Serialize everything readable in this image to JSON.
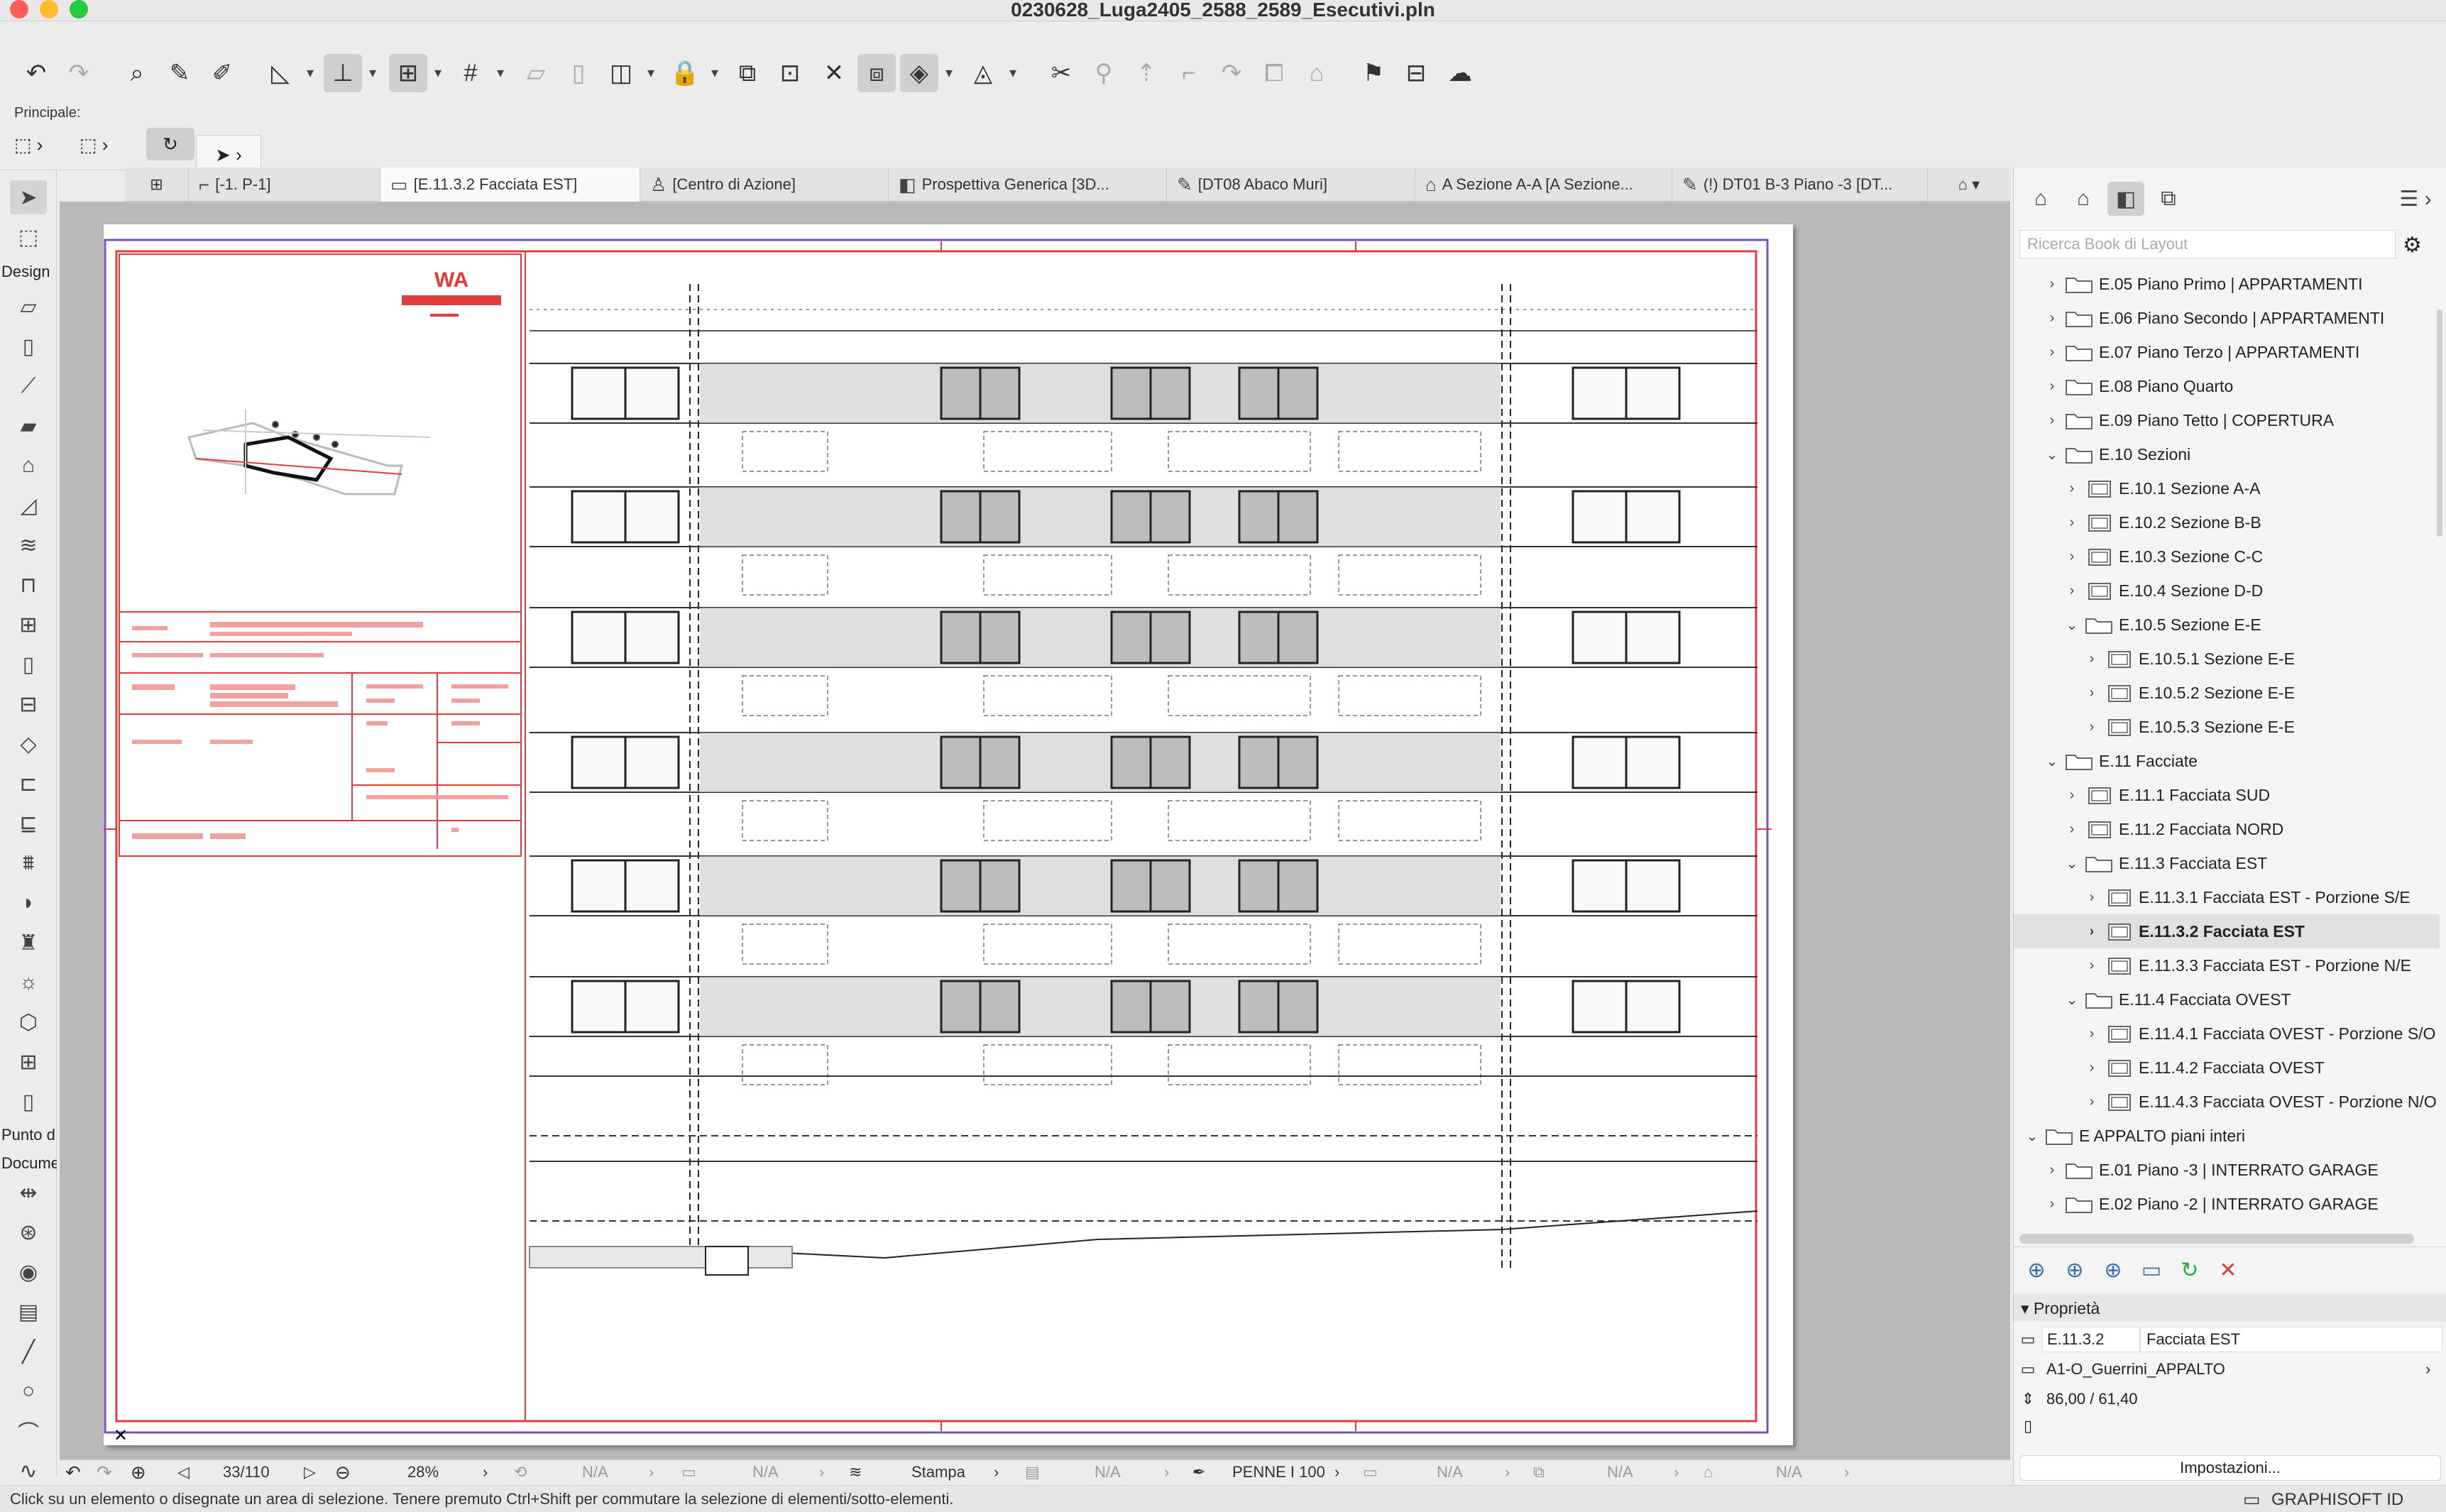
{
  "window": {
    "title": "0230628_Luga2405_2588_2589_Esecutivi.pln"
  },
  "toolbar": {
    "principale_label": "Principale:",
    "icons": [
      "undo-icon",
      "redo-icon",
      "find-select-icon",
      "eyedropper-icon",
      "inject-icon",
      "measure-icon",
      "snap-guides-icon",
      "snap-points-icon",
      "grid-snap-icon",
      "layer-icon",
      "3d-view-icon",
      "display-icon",
      "lock-icon",
      "elevation-icon",
      "label-icon",
      "trace-icon",
      "fit-selection-icon",
      "zoom-window-icon",
      "orbit-icon",
      "scissors-icon",
      "wand-icon",
      "move-icon",
      "rotate-icon",
      "mirror-icon",
      "elevate-icon",
      "stretch-icon",
      "flag-icon",
      "schedule-icon",
      "cloud-icon"
    ]
  },
  "tabs": [
    {
      "label": "[-1. P-1]",
      "icon": "floorplan-icon"
    },
    {
      "label": "[E.11.3.2 Facciata EST]",
      "icon": "layout-icon",
      "active": true
    },
    {
      "label": "[Centro di Azione]",
      "icon": "action-center-icon"
    },
    {
      "label": "Prospettiva Generica [3D...",
      "icon": "3d-icon"
    },
    {
      "label": "[DT08 Abaco Muri]",
      "icon": "schedule-icon"
    },
    {
      "label": "A Sezione A-A [A Sezione...",
      "icon": "section-icon"
    },
    {
      "label": "(!) DT01 B-3 Piano -3 [DT...",
      "icon": "detail-icon"
    }
  ],
  "toolbox": {
    "design_label": "Design",
    "punto_label": "Punto d",
    "docum_label": "Docume"
  },
  "bottom": {
    "page": "33/110",
    "zoom": "28%",
    "na": "N/A",
    "stampa": "Stampa",
    "penne": "PENNE I 100"
  },
  "status": {
    "message": "Click su un elemento o disegnate un area di selezione. Tenere premuto Ctrl+Shift per commutare la selezione di elementi/sotto-elementi.",
    "brand": "GRAPHISOFT ID"
  },
  "panel": {
    "search_placeholder": "Ricerca Book di Layout",
    "tree": [
      {
        "label": "E.05 Piano Primo | APPARTAMENTI",
        "level": 1,
        "type": "folder",
        "state": "closed"
      },
      {
        "label": "E.06 Piano Secondo | APPARTAMENTI",
        "level": 1,
        "type": "folder",
        "state": "closed"
      },
      {
        "label": "E.07 Piano Terzo | APPARTAMENTI",
        "level": 1,
        "type": "folder",
        "state": "closed"
      },
      {
        "label": "E.08 Piano Quarto",
        "level": 1,
        "type": "folder",
        "state": "closed"
      },
      {
        "label": "E.09 Piano Tetto | COPERTURA",
        "level": 1,
        "type": "folder",
        "state": "closed"
      },
      {
        "label": "E.10 Sezioni",
        "level": 1,
        "type": "folder",
        "state": "open"
      },
      {
        "label": "E.10.1 Sezione A-A",
        "level": 2,
        "type": "layout",
        "state": "closed"
      },
      {
        "label": "E.10.2 Sezione B-B",
        "level": 2,
        "type": "layout",
        "state": "closed"
      },
      {
        "label": "E.10.3 Sezione C-C",
        "level": 2,
        "type": "layout",
        "state": "closed"
      },
      {
        "label": "E.10.4 Sezione D-D",
        "level": 2,
        "type": "layout",
        "state": "closed"
      },
      {
        "label": "E.10.5 Sezione E-E",
        "level": 2,
        "type": "folder",
        "state": "open"
      },
      {
        "label": "E.10.5.1 Sezione E-E",
        "level": 3,
        "type": "layout",
        "state": "closed"
      },
      {
        "label": "E.10.5.2 Sezione E-E",
        "level": 3,
        "type": "layout",
        "state": "closed"
      },
      {
        "label": "E.10.5.3 Sezione E-E",
        "level": 3,
        "type": "layout",
        "state": "closed"
      },
      {
        "label": "E.11 Facciate",
        "level": 1,
        "type": "folder",
        "state": "open"
      },
      {
        "label": "E.11.1 Facciata SUD",
        "level": 2,
        "type": "layout",
        "state": "closed"
      },
      {
        "label": "E.11.2 Facciata NORD",
        "level": 2,
        "type": "layout",
        "state": "closed"
      },
      {
        "label": "E.11.3 Facciata EST",
        "level": 2,
        "type": "folder",
        "state": "open"
      },
      {
        "label": "E.11.3.1 Facciata EST - Porzione S/E",
        "level": 3,
        "type": "layout",
        "state": "closed"
      },
      {
        "label": "E.11.3.2 Facciata EST",
        "level": 3,
        "type": "layout",
        "state": "closed",
        "selected": true
      },
      {
        "label": "E.11.3.3 Facciata EST - Porzione N/E",
        "level": 3,
        "type": "layout",
        "state": "closed"
      },
      {
        "label": "E.11.4 Facciata OVEST",
        "level": 2,
        "type": "folder",
        "state": "open"
      },
      {
        "label": "E.11.4.1 Facciata OVEST - Porzione S/O",
        "level": 3,
        "type": "layout",
        "state": "closed"
      },
      {
        "label": "E.11.4.2 Facciata OVEST",
        "level": 3,
        "type": "layout",
        "state": "closed"
      },
      {
        "label": "E.11.4.3 Facciata OVEST - Porzione N/O",
        "level": 3,
        "type": "layout",
        "state": "closed"
      },
      {
        "label": "E APPALTO piani interi",
        "level": 0,
        "type": "folder",
        "state": "open"
      },
      {
        "label": "E.01 Piano -3 | INTERRATO GARAGE",
        "level": 1,
        "type": "folder",
        "state": "closed"
      },
      {
        "label": "E.02 Piano -2 | INTERRATO GARAGE",
        "level": 1,
        "type": "folder",
        "state": "closed"
      }
    ],
    "props_title": "Proprietà",
    "prop_id": "E.11.3.2",
    "prop_name": "Facciata EST",
    "prop_master": "A1-O_Guerrini_APPALTO",
    "prop_size": "86,00 / 61,40",
    "settings_label": "Impostazioni..."
  },
  "colors": {
    "accent_red": "#e03c3c",
    "selection_blue": "#3a6ea5"
  }
}
